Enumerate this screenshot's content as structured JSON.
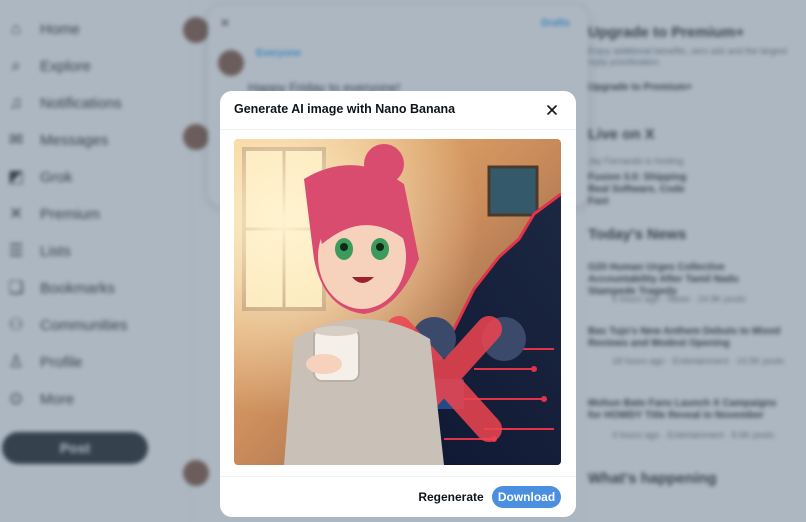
{
  "sidebar": {
    "items": [
      {
        "label": "Home",
        "icon": "home-icon"
      },
      {
        "label": "Explore",
        "icon": "search-icon"
      },
      {
        "label": "Notifications",
        "icon": "bell-icon"
      },
      {
        "label": "Messages",
        "icon": "mail-icon"
      },
      {
        "label": "Grok",
        "icon": "grok-icon"
      },
      {
        "label": "Premium",
        "icon": "x-logo-icon"
      },
      {
        "label": "Lists",
        "icon": "list-icon"
      },
      {
        "label": "Bookmarks",
        "icon": "bookmark-icon"
      },
      {
        "label": "Communities",
        "icon": "people-icon"
      },
      {
        "label": "Profile",
        "icon": "person-icon"
      },
      {
        "label": "More",
        "icon": "more-circle-icon"
      }
    ],
    "post_label": "Post"
  },
  "compose": {
    "drafts_label": "Drafts",
    "audience_label": "Everyone",
    "text": "Happy Friday to everyone!"
  },
  "right_column": {
    "premium_title": "Upgrade to Premium+",
    "premium_desc": "Enjoy additional benefits, zero ads and the largest reply prioritization.",
    "premium_button": "Upgrade to Premium+",
    "live_title": "Live on X",
    "live_host": "Jay Fernando is hosting",
    "live_desc": "Fusion 3.0: Shipping Real Software, Code Fast",
    "news_title": "Today's News",
    "news": [
      {
        "title": "G20 Human Urges Collective Accountability After Tamil Nadu Stampede Tragedy",
        "meta": "5 hours ago · News · 24.9K posts"
      },
      {
        "title": "Bas Tujo's New Anthem Debuts to Mixed Reviews and Modest Opening",
        "meta": "18 hours ago · Entertainment · 14.5K posts"
      },
      {
        "title": "Mohun Bato Fans Launch X Campaigns for HOWDY Title Reveal in November",
        "meta": "4 hours ago · Entertainment · 8.6K posts"
      }
    ],
    "happening_title": "What's happening"
  },
  "dialog": {
    "title": "Generate AI image with Nano Banana",
    "regenerate_label": "Regenerate",
    "download_label": "Download"
  },
  "colors": {
    "accent": "#4a8fe0",
    "overlay": "rgba(91,112,131,0.5)"
  }
}
